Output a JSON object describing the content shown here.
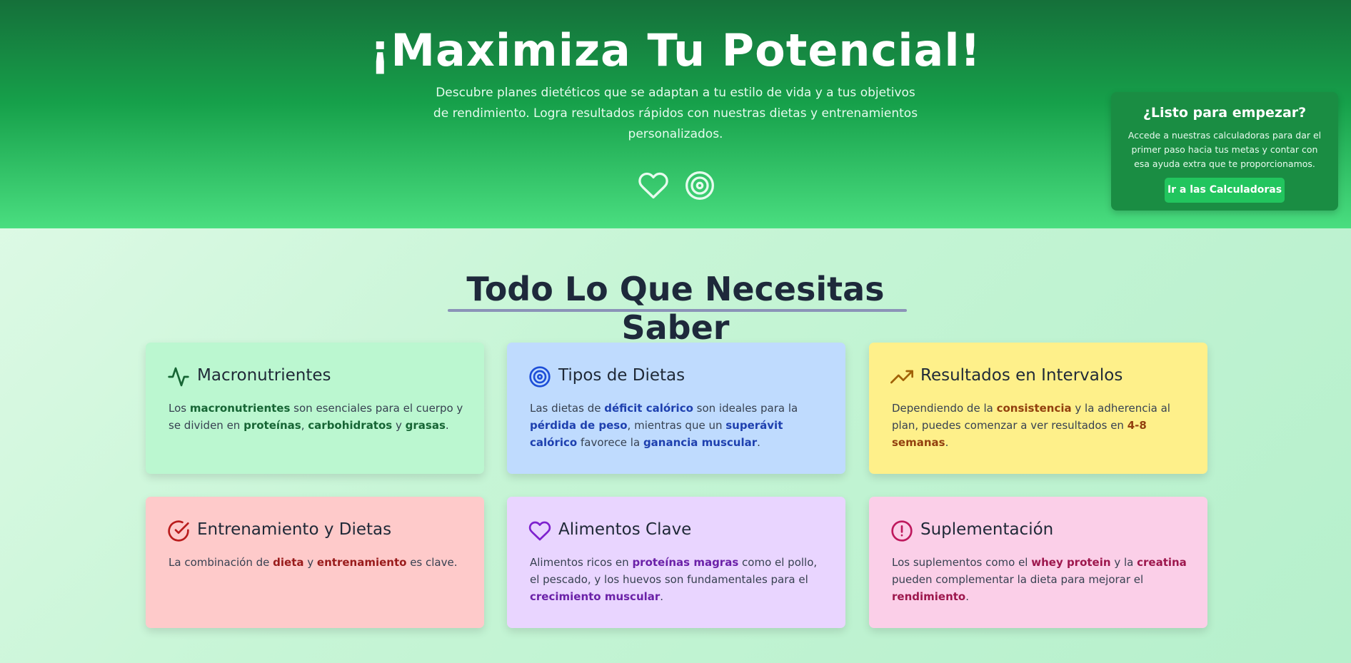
{
  "hero": {
    "title": "¡Maximiza Tu Potencial!",
    "description": "Descubre planes dietéticos que se adaptan a tu estilo de vida y a tus objetivos de rendimiento. Logra resultados rápidos con nuestras dietas y entrenamientos personalizados.",
    "icons": [
      "heart-icon",
      "target-icon"
    ]
  },
  "cta": {
    "title": "¿Listo para empezar?",
    "text": "Accede a nuestras calculadoras para dar el primer paso hacia tus metas y contar con esa ayuda extra que te proporcionamos.",
    "button_label": "Ir a las Calculadoras"
  },
  "section": {
    "title": "Todo Lo Que Necesitas Saber"
  },
  "cards": [
    {
      "icon": "activity-icon",
      "title": "Macronutrientes",
      "accent": "#166534",
      "body": [
        {
          "t": "Los "
        },
        {
          "t": "macronutrientes",
          "b": true
        },
        {
          "t": " son esenciales para el cuerpo y se dividen en "
        },
        {
          "t": "proteínas",
          "b": true
        },
        {
          "t": ", "
        },
        {
          "t": "carbohidratos",
          "b": true
        },
        {
          "t": " y "
        },
        {
          "t": "grasas",
          "b": true
        },
        {
          "t": "."
        }
      ]
    },
    {
      "icon": "target-icon",
      "title": "Tipos de Dietas",
      "accent": "#1e40af",
      "body": [
        {
          "t": "Las dietas de "
        },
        {
          "t": "déficit calórico",
          "b": true
        },
        {
          "t": " son ideales para la "
        },
        {
          "t": "pérdida de peso",
          "b": true
        },
        {
          "t": ", mientras que un "
        },
        {
          "t": "superávit calórico",
          "b": true
        },
        {
          "t": " favorece la "
        },
        {
          "t": "ganancia muscular",
          "b": true
        },
        {
          "t": "."
        }
      ]
    },
    {
      "icon": "trending-up-icon",
      "title": "Resultados en Intervalos",
      "accent": "#92400e",
      "body": [
        {
          "t": "Dependiendo de la "
        },
        {
          "t": "consistencia",
          "b": true
        },
        {
          "t": " y la adherencia al plan, puedes comenzar a ver resultados en "
        },
        {
          "t": "4-8 semanas",
          "b": true
        },
        {
          "t": "."
        }
      ]
    },
    {
      "icon": "check-circle-icon",
      "title": "Entrenamiento y Dietas",
      "accent": "#b91c1c",
      "body": [
        {
          "t": "La combinación de "
        },
        {
          "t": "dieta",
          "b": true
        },
        {
          "t": " y "
        },
        {
          "t": "entrenamiento",
          "b": true
        },
        {
          "t": " es clave."
        }
      ]
    },
    {
      "icon": "heart-icon",
      "title": "Alimentos Clave",
      "accent": "#7e22ce",
      "body": [
        {
          "t": "Alimentos ricos en "
        },
        {
          "t": "proteínas magras",
          "b": true
        },
        {
          "t": " como el pollo, el pescado, y los huevos son fundamentales para el "
        },
        {
          "t": "crecimiento muscular",
          "b": true
        },
        {
          "t": "."
        }
      ]
    },
    {
      "icon": "alert-circle-icon",
      "title": "Suplementación",
      "accent": "#be185d",
      "body": [
        {
          "t": "Los suplementos como el "
        },
        {
          "t": "whey protein",
          "b": true
        },
        {
          "t": " y la "
        },
        {
          "t": "creatina",
          "b": true
        },
        {
          "t": " pueden complementar la dieta para mejorar el "
        },
        {
          "t": "rendimiento",
          "b": true
        },
        {
          "t": "."
        }
      ]
    }
  ]
}
